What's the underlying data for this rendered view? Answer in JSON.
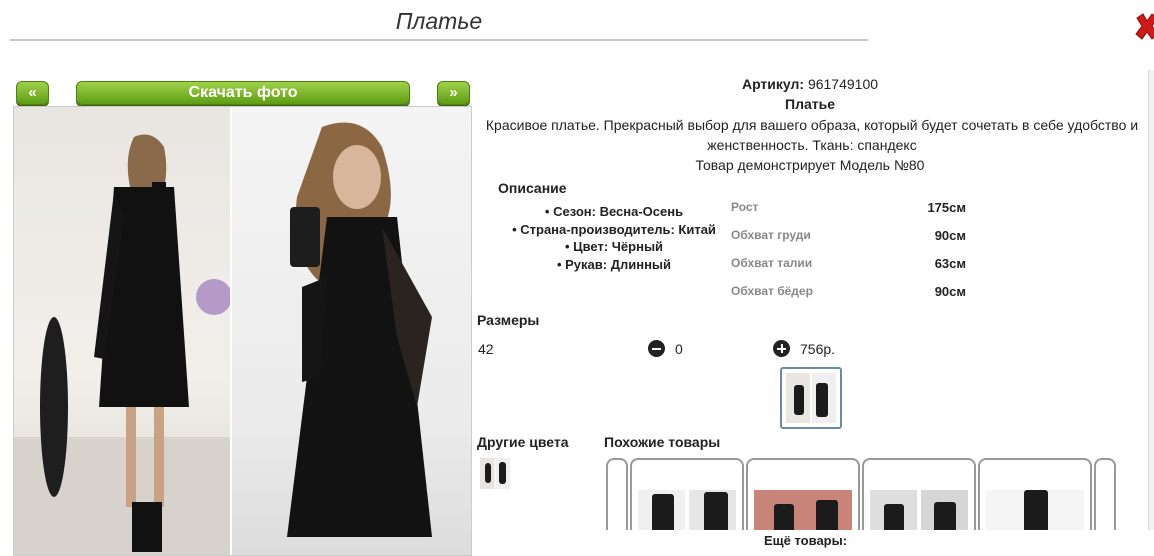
{
  "page": {
    "title": "Платье"
  },
  "gallery": {
    "prev_label": "«",
    "next_label": "»",
    "download_label": "Скачать фото"
  },
  "product": {
    "sku_label": "Артикул:",
    "sku_value": "961749100",
    "name": "Платье",
    "description": "Красивое платье. Прекрасный выбор для вашего образа, который будет сочетать в себе удобство и женственность. Ткань: спандекс",
    "model_note": "Товар демонстрирует Модель №80"
  },
  "description_section": {
    "title": "Описание",
    "items": [
      "Сезон: Весна-Осень",
      "Страна-производитель: Китай",
      "Цвет: Чёрный",
      "Рукав: Длинный"
    ]
  },
  "measurements": [
    {
      "label": "Рост",
      "value": "175см"
    },
    {
      "label": "Обхват груди",
      "value": "90см"
    },
    {
      "label": "Обхват талии",
      "value": "63см"
    },
    {
      "label": "Обхват бёдер",
      "value": "90см"
    }
  ],
  "sizes": {
    "title": "Размеры",
    "rows": [
      {
        "size": "42",
        "quantity": "0",
        "price": "756р."
      }
    ]
  },
  "other_colors": {
    "title": "Другие цвета"
  },
  "similar": {
    "title": "Похожие товары"
  },
  "more": {
    "title": "Ещё товары:"
  },
  "colors": {
    "button_green": "#6aa81a",
    "close_red": "#d01a1a"
  },
  "icons": {
    "close": "close-icon",
    "minus": "minus-circle-icon",
    "plus": "plus-circle-icon"
  }
}
